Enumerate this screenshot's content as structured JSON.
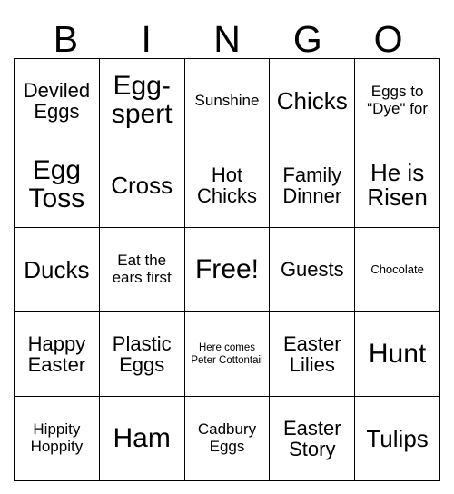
{
  "card": {
    "title": "BINGO",
    "header_letters": [
      "B",
      "I",
      "N",
      "G",
      "O"
    ],
    "columns": 5,
    "rows": 5,
    "free_space_label": "Free!",
    "border_color": "#000000",
    "background_color": "#ffffff",
    "text_color": "#000000"
  },
  "grid": {
    "rows": [
      {
        "cells": [
          {
            "text": "Deviled Eggs",
            "size": "md"
          },
          {
            "text": "Egg-spert",
            "size": "xl"
          },
          {
            "text": "Sunshine",
            "size": "sm"
          },
          {
            "text": "Chicks",
            "size": "lg"
          },
          {
            "text": "Eggs to \"Dye\" for",
            "size": "sm"
          }
        ]
      },
      {
        "cells": [
          {
            "text": "Egg Toss",
            "size": "xl"
          },
          {
            "text": "Cross",
            "size": "lg"
          },
          {
            "text": "Hot Chicks",
            "size": "md"
          },
          {
            "text": "Family Dinner",
            "size": "md"
          },
          {
            "text": "He is Risen",
            "size": "lg"
          }
        ]
      },
      {
        "cells": [
          {
            "text": "Ducks",
            "size": "lg"
          },
          {
            "text": "Eat the ears first",
            "size": "sm"
          },
          {
            "text": "Free!",
            "size": "xl"
          },
          {
            "text": "Guests",
            "size": "md"
          },
          {
            "text": "Chocolate",
            "size": "xs"
          }
        ]
      },
      {
        "cells": [
          {
            "text": "Happy Easter",
            "size": "md"
          },
          {
            "text": "Plastic Eggs",
            "size": "md"
          },
          {
            "text": "Here comes Peter Cottontail",
            "size": "xxs"
          },
          {
            "text": "Easter Lilies",
            "size": "md"
          },
          {
            "text": "Hunt",
            "size": "xl"
          }
        ]
      },
      {
        "cells": [
          {
            "text": "Hippity Hoppity",
            "size": "sm"
          },
          {
            "text": "Ham",
            "size": "xl"
          },
          {
            "text": "Cadbury Eggs",
            "size": "sm"
          },
          {
            "text": "Easter Story",
            "size": "md"
          },
          {
            "text": "Tulips",
            "size": "lg"
          }
        ]
      }
    ]
  }
}
